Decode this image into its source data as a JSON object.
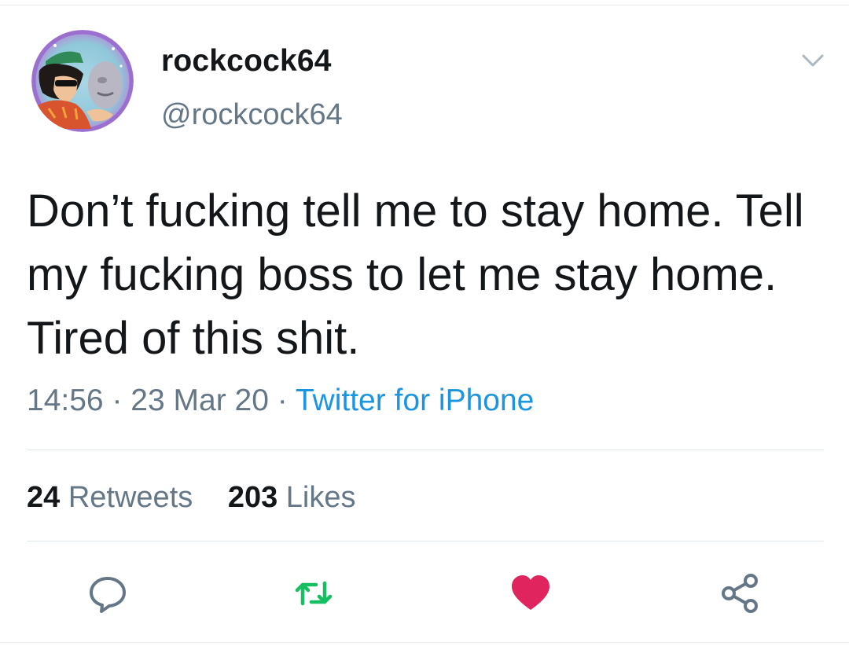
{
  "tweet": {
    "display_name": "rockcock64",
    "handle": "@rockcock64",
    "text": "Don’t fucking tell me to stay home. Tell my fucking boss to let me stay home. Tired of this shit.",
    "time": "14:56",
    "date": "23 Mar 20",
    "separator": "·",
    "source": "Twitter for iPhone",
    "retweets_count": "24",
    "retweets_label": "Retweets",
    "likes_count": "203",
    "likes_label": "Likes"
  },
  "icons": {
    "caret": "chevron-down-icon",
    "reply": "reply-icon",
    "retweet": "retweet-icon",
    "like": "heart-icon",
    "share": "share-icon"
  },
  "colors": {
    "secondary_text": "#657786",
    "link": "#1b95e0",
    "retweet_active": "#17bf63",
    "like_active": "#e0245e"
  }
}
